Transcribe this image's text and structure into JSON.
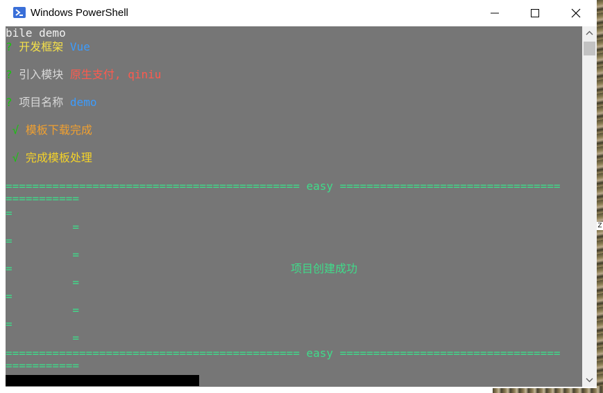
{
  "window": {
    "title": "Windows PowerShell",
    "icon": "powershell-icon",
    "controls": [
      "minimize-icon",
      "maximize-icon",
      "close-icon"
    ]
  },
  "console": {
    "first_line": "bile demo",
    "q1": {
      "mark": "?",
      "label": " 开发框架 ",
      "value": "Vue"
    },
    "q2": {
      "mark": "?",
      "label": " 引入模块 ",
      "value": "原生支付, qiniu"
    },
    "q3": {
      "mark": "?",
      "label": " 项目名称 ",
      "value": "demo"
    },
    "s1": {
      "mark": " √ ",
      "text": "模板下载完成"
    },
    "s2": {
      "mark": " √ ",
      "text": "完成模板处理"
    },
    "banner_top": "============================================ easy =================================",
    "banner_top_wrap": "===========",
    "eq": "=",
    "eq_indented": "          =",
    "message": "项目创建成功",
    "banner_bottom": "============================================ easy =================================",
    "banner_bottom_wrap": "==========="
  },
  "colors": {
    "console_bg": "#767676",
    "question_mark": "#16c60c",
    "framework_value": "#3b9cff",
    "module_value": "#ff5a4e",
    "done_text_1": "#f0a030",
    "done_text_2": "#f5d328",
    "banner": "#3fdc8a"
  }
}
